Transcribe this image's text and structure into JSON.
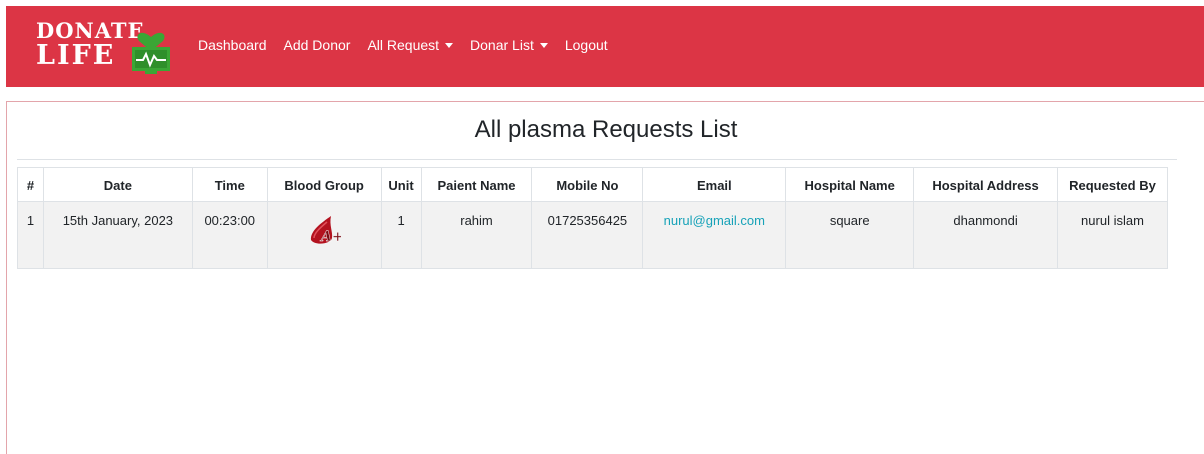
{
  "brand": {
    "line1": "DONATE",
    "line2": "LIFE"
  },
  "nav": {
    "dashboard": "Dashboard",
    "add_donor": "Add Donor",
    "all_request": "All Request",
    "donar_list": "Donar List",
    "logout": "Logout"
  },
  "page": {
    "title": "All plasma Requests List"
  },
  "table": {
    "headers": [
      "#",
      "Date",
      "Time",
      "Blood Group",
      "Unit",
      "Paient Name",
      "Mobile No",
      "Email",
      "Hospital Name",
      "Hospital Address",
      "Requested By"
    ],
    "rows": [
      {
        "index": "1",
        "date": "15th January, 2023",
        "time": "00:23:00",
        "blood_group": "A+",
        "unit": "1",
        "patient_name": "rahim",
        "mobile": "01725356425",
        "email": "nurul@gmail.com",
        "hospital_name": "square",
        "hospital_address": "dhanmondi",
        "requested_by": "nurul islam"
      }
    ]
  },
  "colors": {
    "navbar": "#dc3545",
    "link": "#17a2b8",
    "logo_green": "#3aa635",
    "blood": "#b3121f"
  }
}
